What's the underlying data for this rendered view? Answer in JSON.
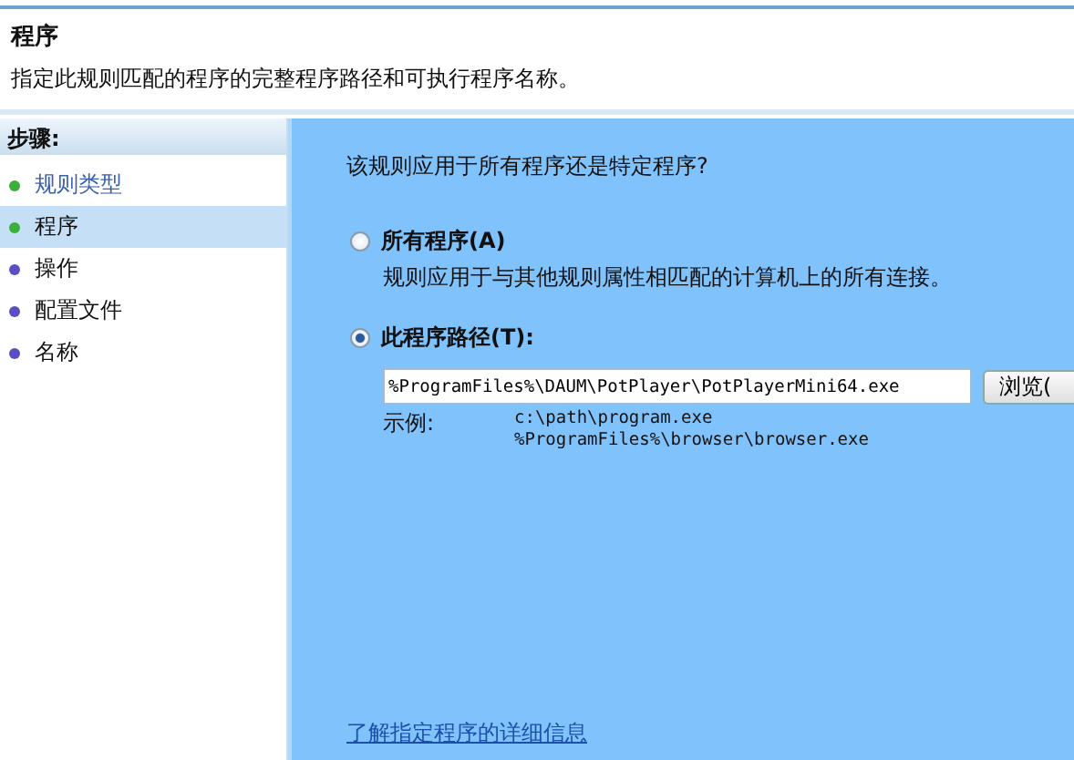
{
  "header": {
    "title": "程序",
    "description": "指定此规则匹配的程序的完整程序路径和可执行程序名称。"
  },
  "steps": {
    "title": "步骤:",
    "items": [
      {
        "label": "规则类型",
        "selected": false,
        "color": "#3cae3c",
        "visited": true
      },
      {
        "label": "程序",
        "selected": true,
        "color": "#3cae3c",
        "visited": false
      },
      {
        "label": "操作",
        "selected": false,
        "color": "#5a4fc0",
        "visited": false
      },
      {
        "label": "配置文件",
        "selected": false,
        "color": "#5a4fc0",
        "visited": false
      },
      {
        "label": "名称",
        "selected": false,
        "color": "#5a4fc0",
        "visited": false
      }
    ]
  },
  "question": "该规则应用于所有程序还是特定程序?",
  "options": [
    {
      "label": "所有程序(A)",
      "description": "规则应用于与其他规则属性相匹配的计算机上的所有连接。",
      "selected": false
    },
    {
      "label": "此程序路径(T):",
      "selected": true
    }
  ],
  "path_field": {
    "value": "%ProgramFiles%\\DAUM\\PotPlayer\\PotPlayerMini64.exe"
  },
  "browse_button": "浏览(",
  "example": {
    "label": "示例:",
    "lines": [
      "c:\\path\\program.exe",
      "%ProgramFiles%\\browser\\browser.exe"
    ]
  },
  "help_link": "了解指定程序的详细信息"
}
